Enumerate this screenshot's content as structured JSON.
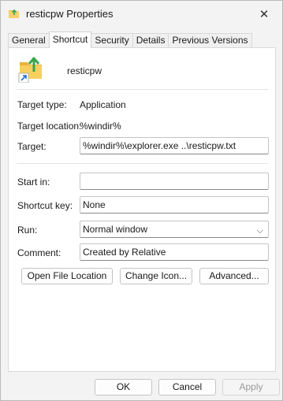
{
  "window": {
    "title": "resticpw Properties",
    "close_icon": "close-icon"
  },
  "tabs": [
    {
      "label": "General",
      "active": false
    },
    {
      "label": "Shortcut",
      "active": true
    },
    {
      "label": "Security",
      "active": false
    },
    {
      "label": "Details",
      "active": false
    },
    {
      "label": "Previous Versions",
      "active": false
    }
  ],
  "shortcut": {
    "name": "resticpw",
    "target_type_label": "Target type:",
    "target_type_value": "Application",
    "target_location_label": "Target location:",
    "target_location_value": "%windir%",
    "target_label": "Target:",
    "target_value": "%windir%\\explorer.exe ..\\resticpw.txt",
    "start_in_label": "Start in:",
    "start_in_value": "",
    "shortcut_key_label": "Shortcut key:",
    "shortcut_key_value": "None",
    "run_label": "Run:",
    "run_value": "Normal window",
    "comment_label": "Comment:",
    "comment_value": "Created by Relative",
    "open_file_location": "Open File Location",
    "change_icon": "Change Icon...",
    "advanced": "Advanced..."
  },
  "footer": {
    "ok": "OK",
    "cancel": "Cancel",
    "apply": "Apply"
  },
  "colors": {
    "folder": "#f2c14e",
    "arrow": "#3aa54a",
    "shortcut_arrow": "#1f6fd1"
  }
}
